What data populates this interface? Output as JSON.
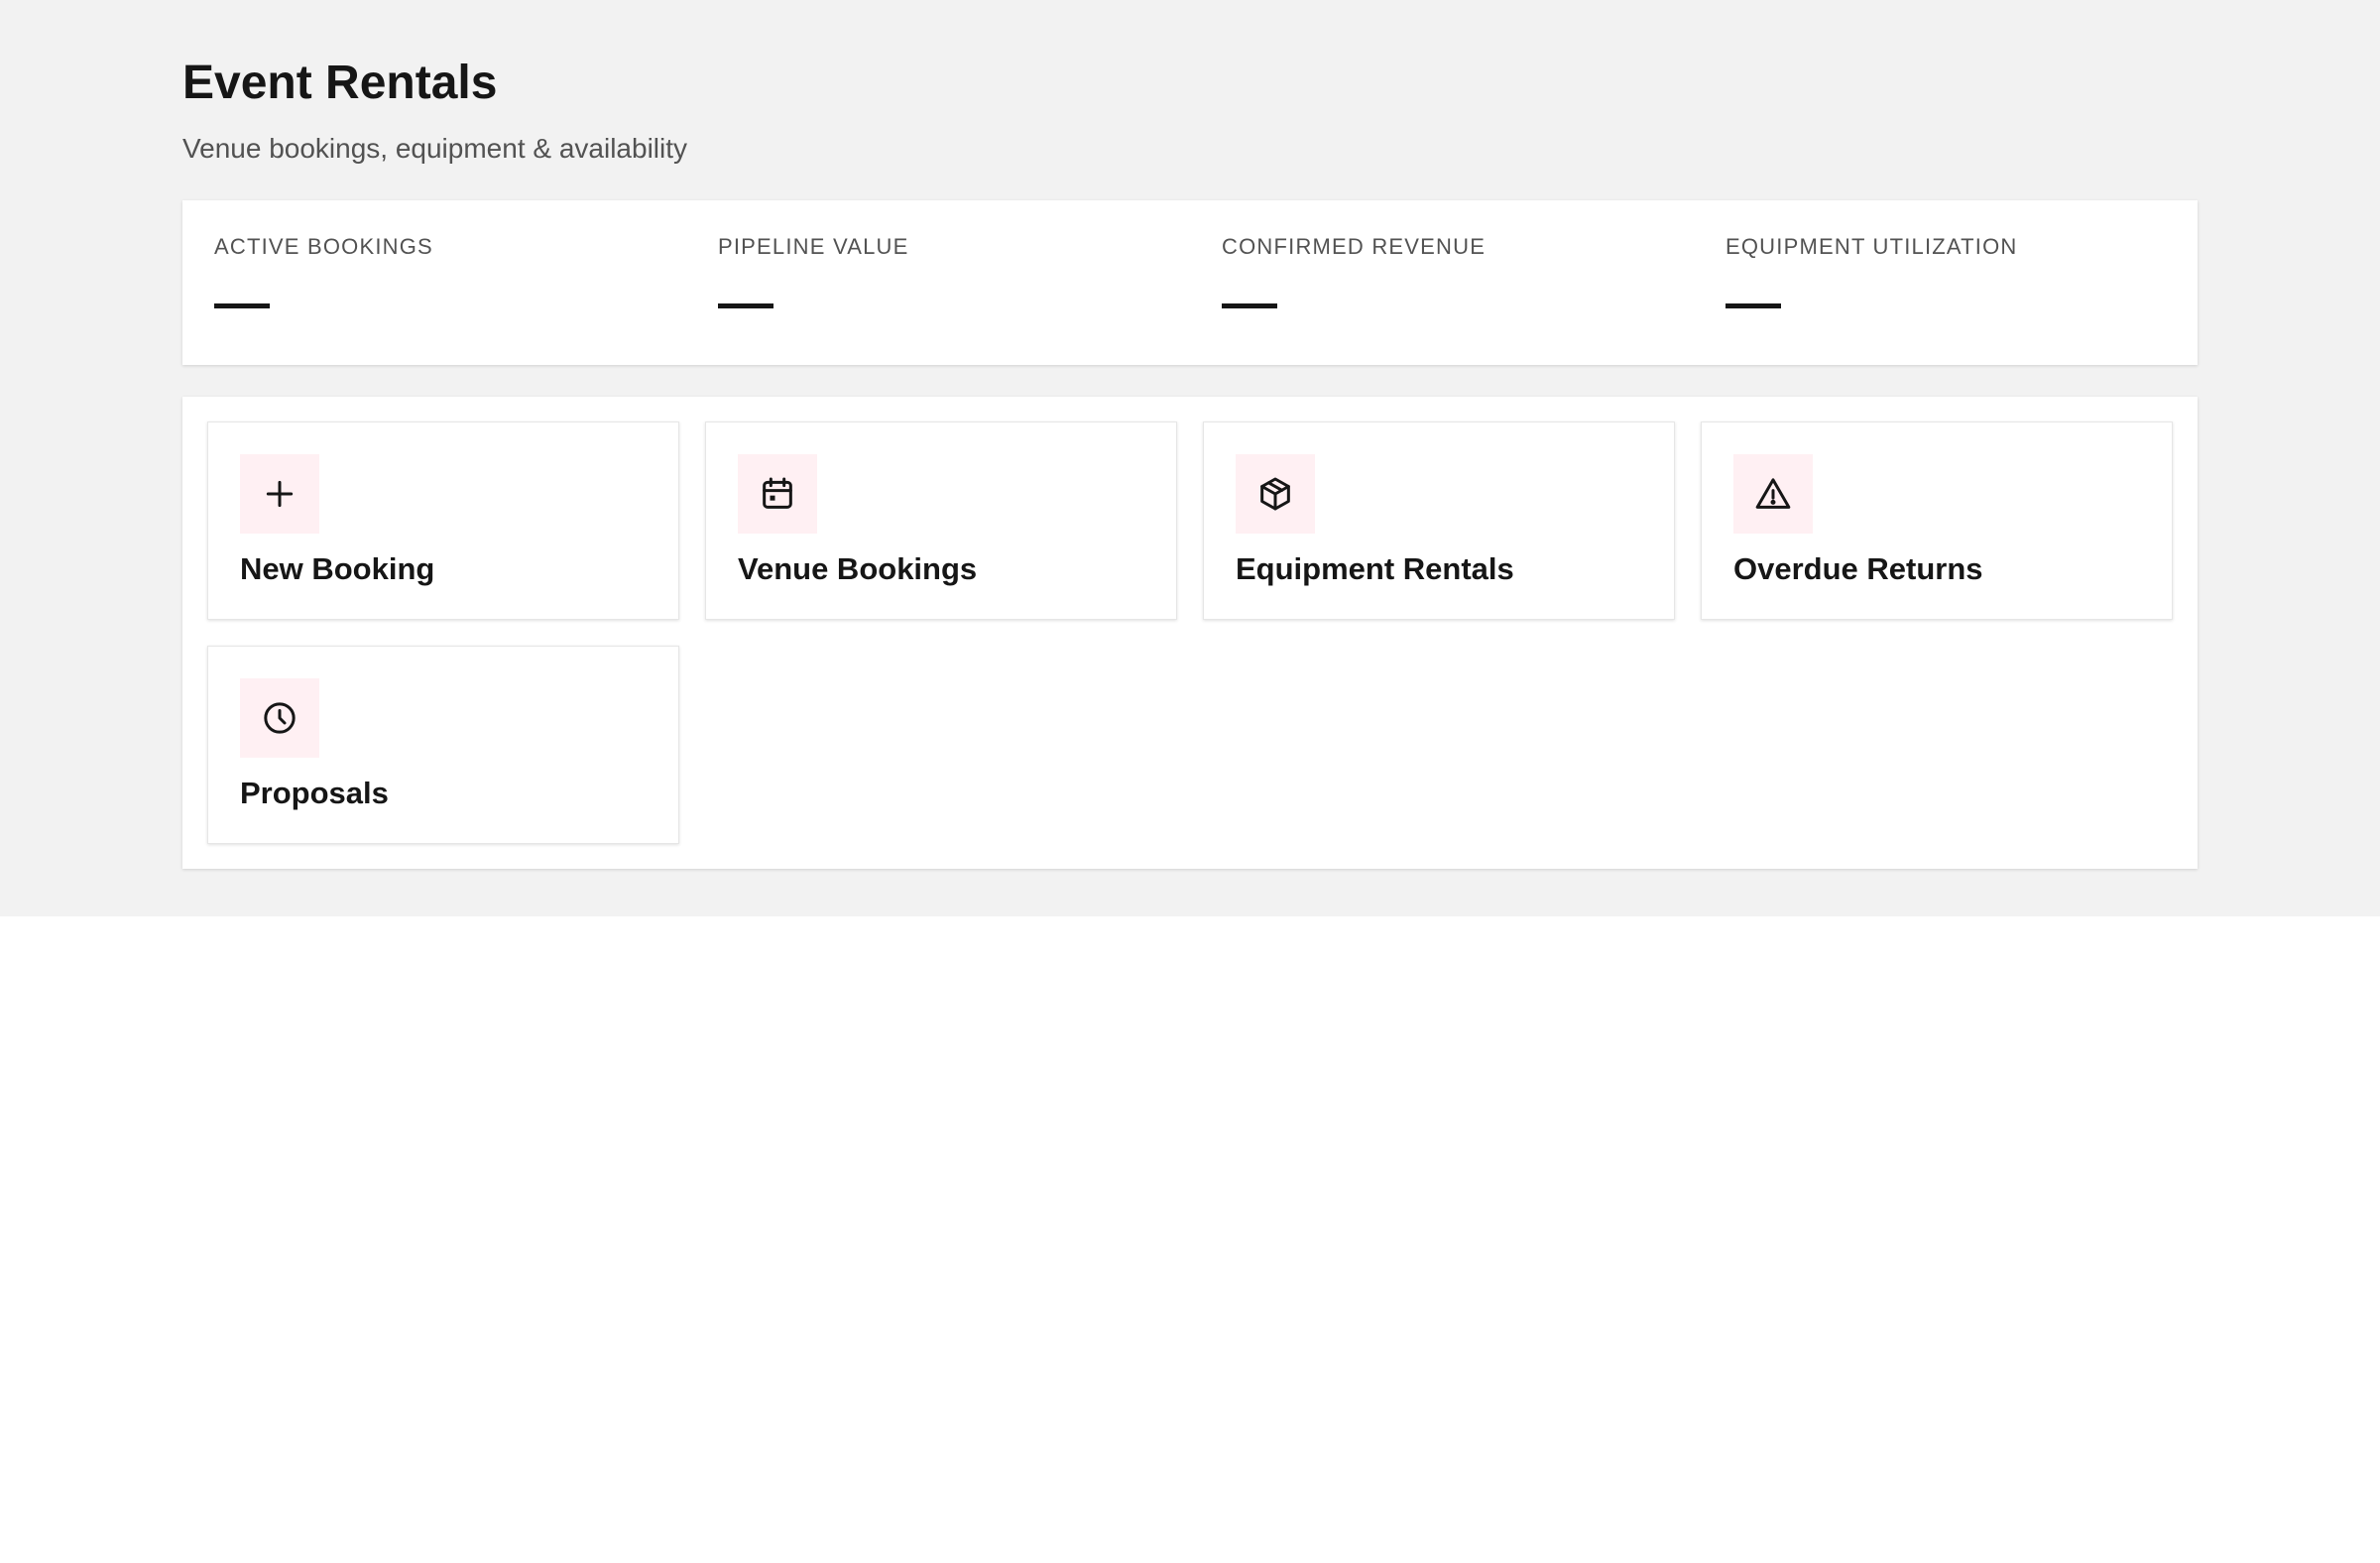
{
  "header": {
    "title": "Event Rentals",
    "subtitle": "Venue bookings, equipment & availability"
  },
  "kpis": [
    {
      "label": "ACTIVE BOOKINGS",
      "value": "—"
    },
    {
      "label": "PIPELINE VALUE",
      "value": "—"
    },
    {
      "label": "CONFIRMED REVENUE",
      "value": "—"
    },
    {
      "label": "EQUIPMENT UTILIZATION",
      "value": "—"
    }
  ],
  "actions": [
    {
      "label": "New Booking",
      "icon": "plus-icon"
    },
    {
      "label": "Venue Bookings",
      "icon": "calendar-icon"
    },
    {
      "label": "Equipment Rentals",
      "icon": "package-icon"
    },
    {
      "label": "Overdue Returns",
      "icon": "warning-icon"
    },
    {
      "label": "Proposals",
      "icon": "clock-icon"
    }
  ],
  "colors": {
    "page_background": "#f2f2f2",
    "icon_background": "#fff0f3",
    "text_primary": "#161616",
    "text_secondary": "#525252"
  }
}
